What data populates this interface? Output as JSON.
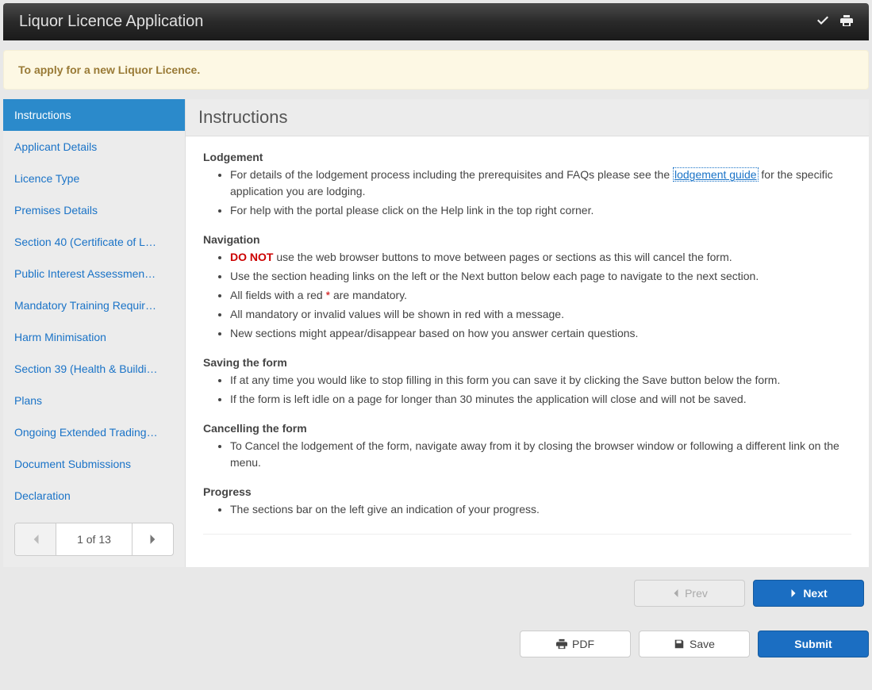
{
  "header": {
    "title": "Liquor Licence Application",
    "icons": {
      "validate": "check-icon",
      "print": "print-icon"
    }
  },
  "intro": {
    "text": "To apply for a new Liquor Licence."
  },
  "sidebar": {
    "active_index": 0,
    "items": [
      "Instructions",
      "Applicant Details",
      "Licence Type",
      "Premises Details",
      "Section 40 (Certificate of L…",
      "Public Interest Assessmen…",
      "Mandatory Training Requir…",
      "Harm Minimisation",
      "Section 39 (Health & Buildi…",
      "Plans",
      "Ongoing Extended Trading…",
      "Document Submissions",
      "Declaration"
    ],
    "pager": {
      "label": "1 of 13"
    }
  },
  "content": {
    "heading": "Instructions",
    "sections": [
      {
        "title": "Lodgement",
        "items": [
          {
            "prefix": "For details of the lodgement process including the prerequisites and FAQs please see the ",
            "link": "lodgement guide",
            "suffix": " for the specific application you are lodging."
          },
          {
            "text": "For help with the portal please click on the Help link in the top right corner."
          }
        ]
      },
      {
        "title": "Navigation",
        "items": [
          {
            "red_lead": "DO NOT",
            "rest": " use the web browser buttons to move between pages or sections as this will cancel the form."
          },
          {
            "text": "Use the section heading links on the left or the Next button below each page to navigate to the next section."
          },
          {
            "prefix": "All fields with a red ",
            "star": "*",
            "suffix": " are mandatory."
          },
          {
            "text": "All mandatory or invalid values will be shown in red with a message."
          },
          {
            "text": "New sections might appear/disappear based on how you answer certain questions."
          }
        ]
      },
      {
        "title": "Saving the form",
        "items": [
          {
            "text": "If at any time you would like to stop filling in this form you can save it by clicking the Save button below the form."
          },
          {
            "text": "If the form is left idle on a page for longer than 30 minutes the application will close and will not be saved."
          }
        ]
      },
      {
        "title": "Cancelling the form",
        "items": [
          {
            "text": "To Cancel the lodgement of the form, navigate away from it by closing the browser window or following a different link on the menu."
          }
        ]
      },
      {
        "title": "Progress",
        "items": [
          {
            "text": "The sections bar on the left give an indication of your progress."
          }
        ]
      }
    ]
  },
  "nav": {
    "prev": "Prev",
    "next": "Next"
  },
  "footer": {
    "pdf": "PDF",
    "save": "Save",
    "submit": "Submit"
  }
}
